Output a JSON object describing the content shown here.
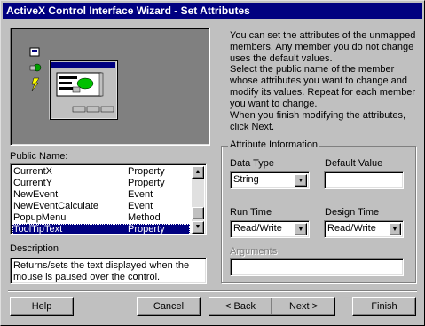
{
  "window": {
    "title": "ActiveX Control Interface Wizard - Set Attributes"
  },
  "intro": {
    "p1": "You can set the attributes of the unmapped members.  Any member you do not change uses the default values.",
    "p2": "Select the public name of the member whose attributes you want to change and modify its values. Repeat for each member you want to change.",
    "p3": "When you finish modifying the attributes, click Next."
  },
  "public_name": {
    "label": "Public Name:",
    "items": [
      {
        "name": "CurrentX",
        "type": "Property"
      },
      {
        "name": "CurrentY",
        "type": "Property"
      },
      {
        "name": "NewEvent",
        "type": "Event"
      },
      {
        "name": "NewEventCalculate",
        "type": "Event"
      },
      {
        "name": "PopupMenu",
        "type": "Method"
      },
      {
        "name": "ToolTipText",
        "type": "Property"
      }
    ],
    "selected": "ToolTipText"
  },
  "description": {
    "label": "Description",
    "text": "Returns/sets the text displayed when the mouse is paused over the control."
  },
  "attributes": {
    "legend": "Attribute Information",
    "data_type_label": "Data Type",
    "data_type_value": "String",
    "default_value_label": "Default Value",
    "default_value": "",
    "run_time_label": "Run Time",
    "run_time_value": "Read/Write",
    "design_time_label": "Design Time",
    "design_time_value": "Read/Write",
    "arguments_label": "Arguments",
    "arguments_value": ""
  },
  "buttons": {
    "help": "Help",
    "cancel": "Cancel",
    "back": "< Back",
    "next": "Next >",
    "finish": "Finish"
  },
  "colors": {
    "title_bar": "#000080",
    "face": "#c0c0c0",
    "selection": "#000080"
  }
}
